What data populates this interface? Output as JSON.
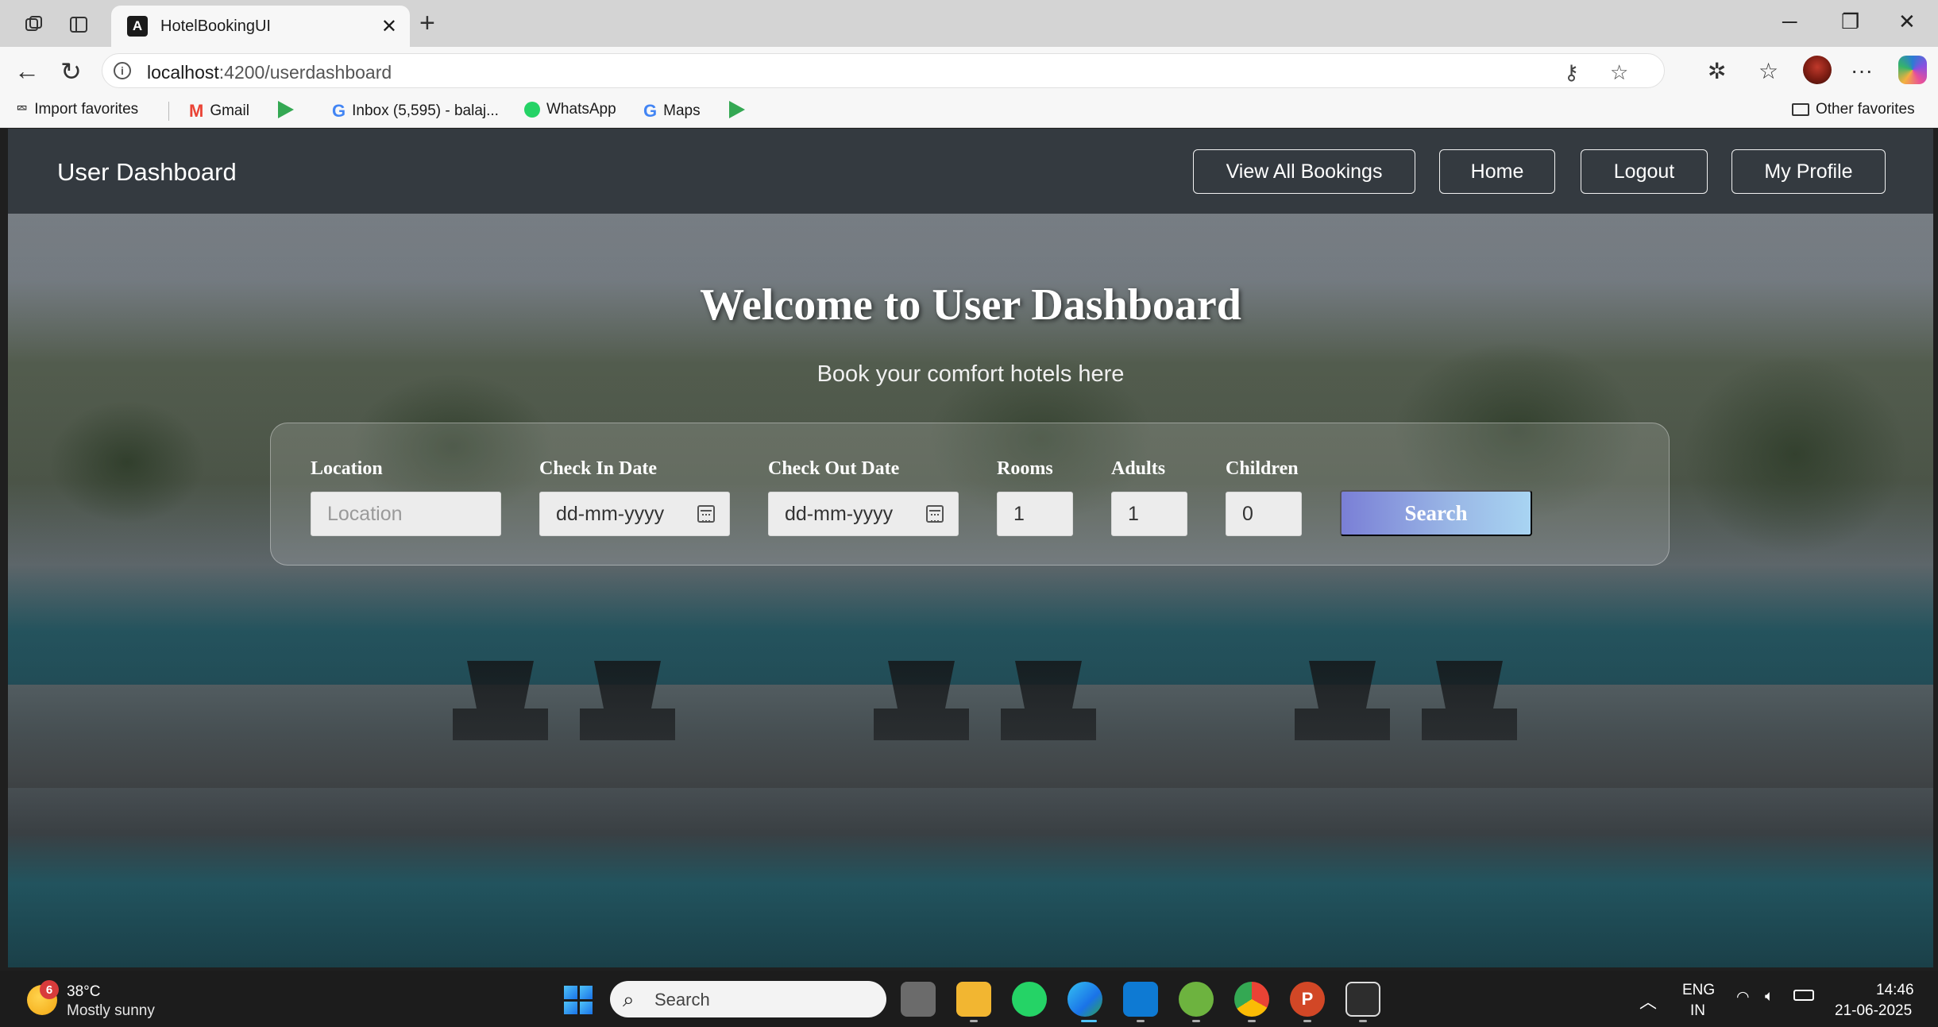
{
  "browser": {
    "tab_title": "HotelBookingUI",
    "tab_logo": "A",
    "url_host": "localhost",
    "url_path": ":4200/userdashboard",
    "favorites": [
      {
        "label": "Import favorites",
        "icon": "import-icon"
      },
      {
        "label": "Gmail",
        "icon": "gmail-icon"
      },
      {
        "label": "",
        "icon": "play-store-icon"
      },
      {
        "label": "Inbox (5,595) - balaj...",
        "icon": "google-icon"
      },
      {
        "label": "WhatsApp",
        "icon": "whatsapp-icon"
      },
      {
        "label": "Maps",
        "icon": "google-icon"
      },
      {
        "label": "",
        "icon": "play-store-icon"
      }
    ],
    "other_favorites": "Other favorites"
  },
  "navbar": {
    "brand": "User Dashboard",
    "buttons": [
      "View All Bookings",
      "Home",
      "Logout",
      "My Profile"
    ],
    "bg_color": "#343a40"
  },
  "hero": {
    "title": "Welcome to User Dashboard",
    "subtitle": "Book your comfort hotels here"
  },
  "search": {
    "location_label": "Location",
    "location_placeholder": "Location",
    "checkin_label": "Check In Date",
    "checkin_placeholder": "dd-mm-yyyy",
    "checkout_label": "Check Out Date",
    "checkout_placeholder": "dd-mm-yyyy",
    "rooms_label": "Rooms",
    "rooms_value": "1",
    "adults_label": "Adults",
    "adults_value": "1",
    "children_label": "Children",
    "children_value": "0",
    "button_label": "Search"
  },
  "taskbar": {
    "weather_badge": "6",
    "temperature": "38°C",
    "weather_desc": "Mostly sunny",
    "search_label": "Search",
    "lang_top": "ENG",
    "lang_bottom": "IN",
    "time": "14:46",
    "date": "21-06-2025"
  }
}
